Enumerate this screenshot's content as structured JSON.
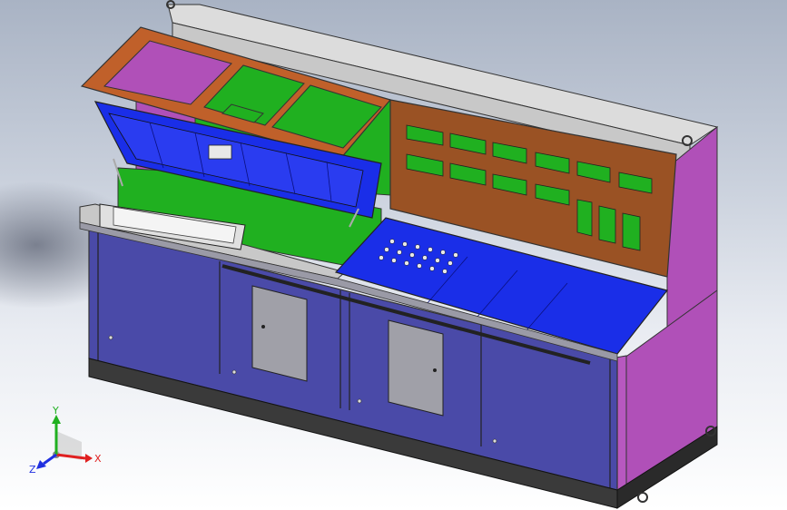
{
  "viewport": {
    "model_colors": {
      "cabinet_body": "#4a4aa8",
      "side_panel": "#b050b8",
      "top_panel": "#dcdcdc",
      "open_frame": "#c0602a",
      "inner_wall": "#20b020",
      "blue_panel": "#1a2ee8",
      "rear_panel": "#9a5224",
      "base_plinth": "#3a3a3a",
      "door_grey": "#a0a0a8"
    }
  },
  "triad": {
    "x_label": "X",
    "y_label": "Y",
    "z_label": "Z",
    "x_color": "#e02020",
    "y_color": "#20b020",
    "z_color": "#2030e0"
  }
}
